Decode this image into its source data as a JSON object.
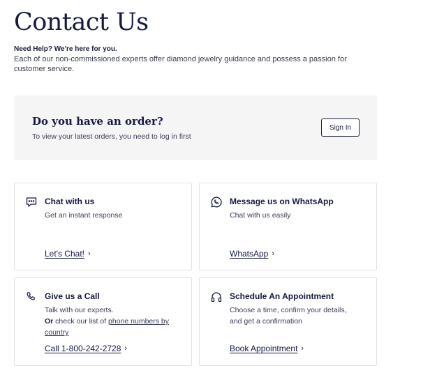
{
  "page": {
    "title": "Contact Us",
    "help_heading": "Need Help? We're here for you.",
    "help_text": "Each of our non-commissioned experts offer diamond jewelry guidance and possess a passion for customer service."
  },
  "order": {
    "title": "Do you have an order?",
    "subtitle": "To view your latest orders, you need to log in first",
    "signin_label": "Sign In"
  },
  "cards": {
    "chat": {
      "icon": "chat-bubble-icon",
      "title": "Chat with us",
      "subtitle": "Get an instant response",
      "link": "Let's Chat!"
    },
    "whatsapp": {
      "icon": "whatsapp-icon",
      "title": "Message us on WhatsApp",
      "subtitle": "Chat with us easily",
      "link": "WhatsApp"
    },
    "call": {
      "icon": "phone-icon",
      "title": "Give us a Call",
      "line1": "Talk with our experts.",
      "or": "Or",
      "line2_prefix": " check our list of ",
      "line2_link": "phone numbers by country",
      "link": "Call 1-800-242-2728"
    },
    "appointment": {
      "icon": "headphones-icon",
      "title": "Schedule An Appointment",
      "line1": "Choose a time, confirm your details,",
      "line2": "and get a confirmation",
      "link": "Book Appointment"
    }
  },
  "chevron": "›",
  "colors": {
    "text_primary": "#161a40",
    "text_secondary": "#3a3d55",
    "panel_bg": "#f5f5f5",
    "card_border": "#e2e2e6"
  }
}
